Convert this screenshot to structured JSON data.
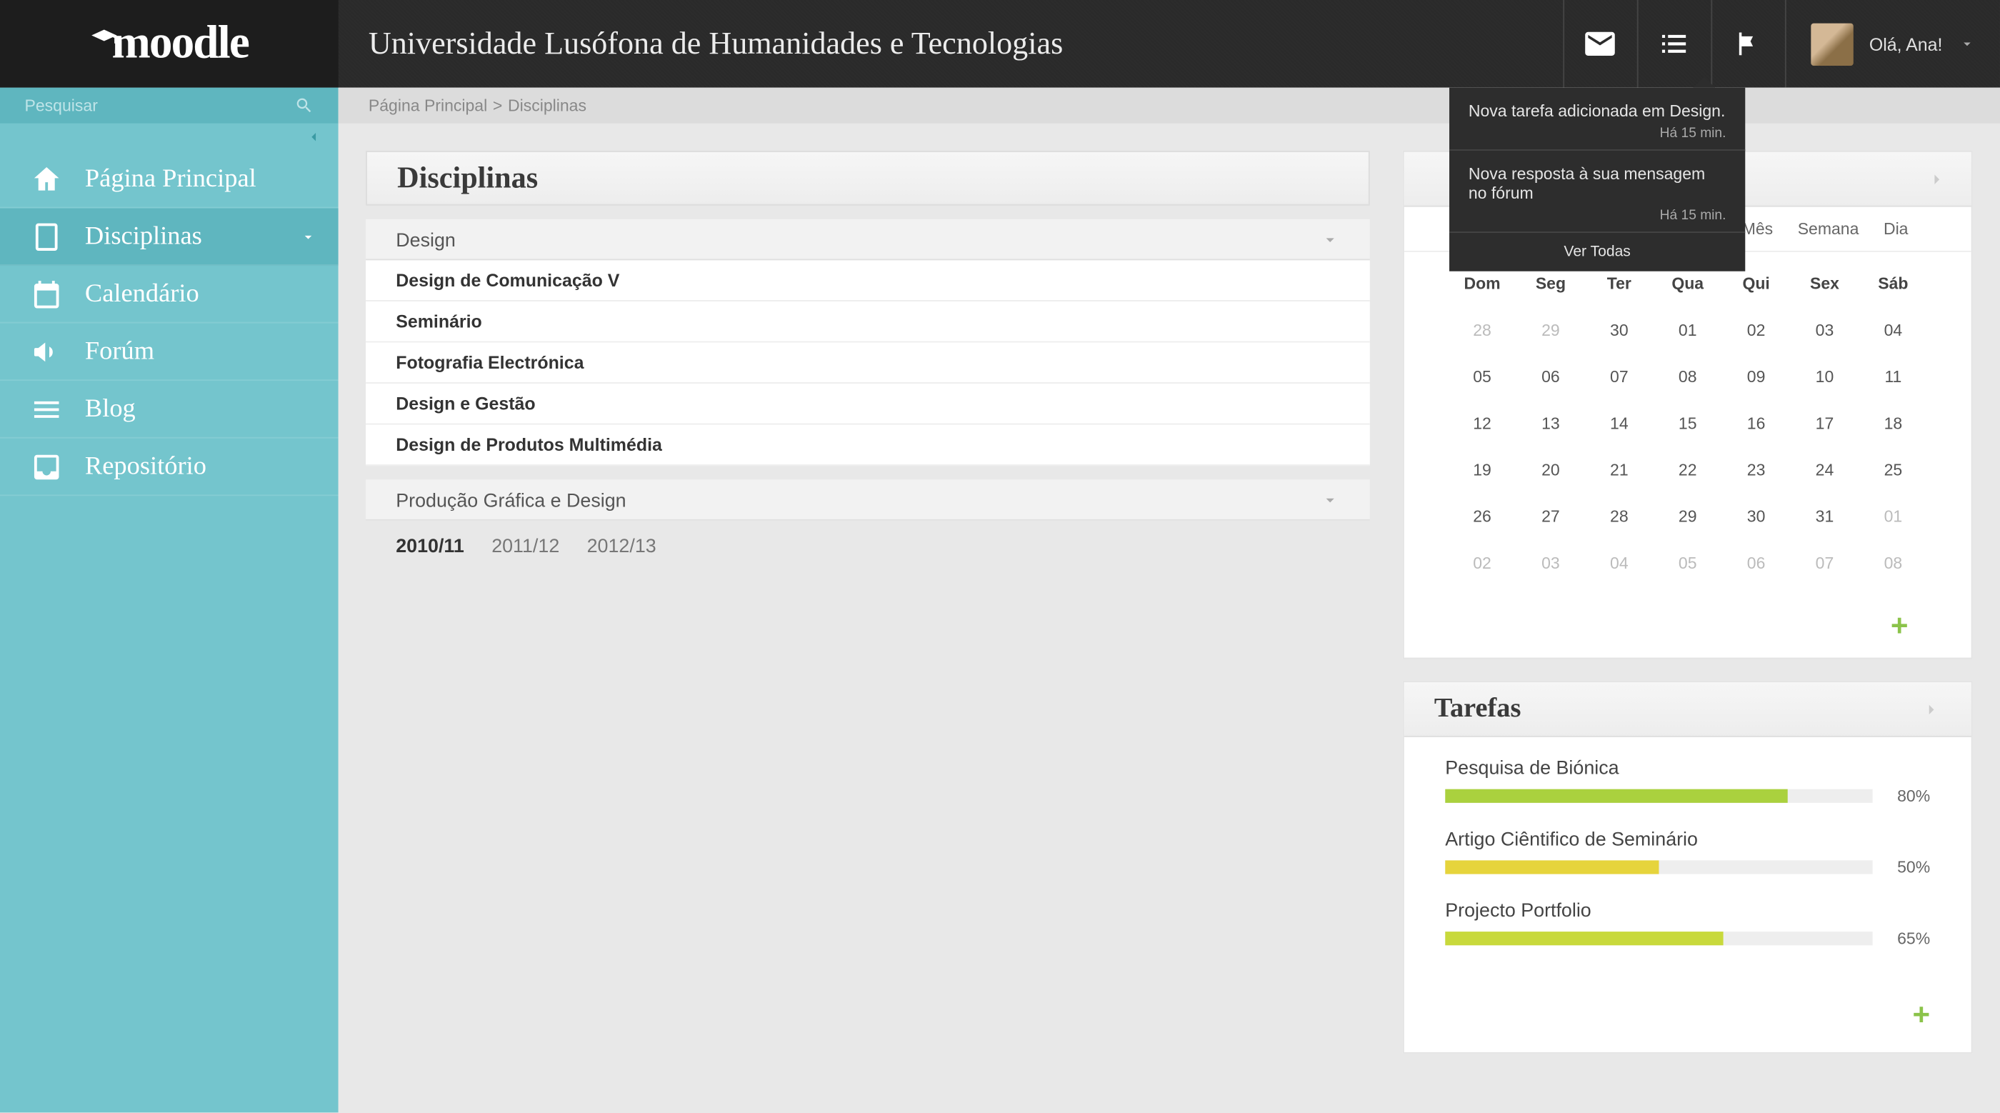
{
  "logo_text": "moodle",
  "header": {
    "university": "Universidade Lusófona de Humanidades e Tecnologias",
    "greeting": "Olá, Ana!"
  },
  "search": {
    "placeholder": "Pesquisar"
  },
  "sidebar": {
    "items": [
      {
        "label": "Página Principal",
        "icon": "home-icon"
      },
      {
        "label": "Disciplinas",
        "icon": "book-icon"
      },
      {
        "label": "Calendário",
        "icon": "calendar-icon"
      },
      {
        "label": "Forúm",
        "icon": "megaphone-icon"
      },
      {
        "label": "Blog",
        "icon": "menu-icon"
      },
      {
        "label": "Repositório",
        "icon": "inbox-icon"
      }
    ]
  },
  "breadcrumb": {
    "home": "Página Principal",
    "sep": ">",
    "current": "Disciplinas"
  },
  "disciplines": {
    "title": "Disciplinas",
    "groups": [
      {
        "name": "Design",
        "expanded": true,
        "courses": [
          "Design de Comunicação V",
          "Seminário",
          "Fotografia Electrónica",
          "Design e Gestão",
          "Design de Produtos Multimédia"
        ]
      },
      {
        "name": "Produção Gráfica e Design",
        "expanded": false,
        "courses": []
      }
    ],
    "years": [
      "2010/11",
      "2011/12",
      "2012/13"
    ],
    "active_year": "2010/11"
  },
  "calendar": {
    "views": [
      "Mês",
      "Semana",
      "Dia"
    ],
    "weekdays": [
      "Dom",
      "Seg",
      "Ter",
      "Qua",
      "Qui",
      "Sex",
      "Sáb"
    ],
    "weeks": [
      [
        {
          "d": "28",
          "m": true
        },
        {
          "d": "29",
          "m": true
        },
        {
          "d": "30",
          "m": false
        },
        {
          "d": "01",
          "m": false
        },
        {
          "d": "02",
          "m": false
        },
        {
          "d": "03",
          "m": false
        },
        {
          "d": "04",
          "m": false
        }
      ],
      [
        {
          "d": "05",
          "m": false
        },
        {
          "d": "06",
          "m": false
        },
        {
          "d": "07",
          "m": false
        },
        {
          "d": "08",
          "m": false
        },
        {
          "d": "09",
          "m": false
        },
        {
          "d": "10",
          "m": false
        },
        {
          "d": "11",
          "m": false
        }
      ],
      [
        {
          "d": "12",
          "m": false
        },
        {
          "d": "13",
          "m": false
        },
        {
          "d": "14",
          "m": false
        },
        {
          "d": "15",
          "m": false
        },
        {
          "d": "16",
          "m": false
        },
        {
          "d": "17",
          "m": false
        },
        {
          "d": "18",
          "m": false
        }
      ],
      [
        {
          "d": "19",
          "m": false
        },
        {
          "d": "20",
          "m": false
        },
        {
          "d": "21",
          "m": false
        },
        {
          "d": "22",
          "m": false
        },
        {
          "d": "23",
          "m": false
        },
        {
          "d": "24",
          "m": false
        },
        {
          "d": "25",
          "m": false
        }
      ],
      [
        {
          "d": "26",
          "m": false
        },
        {
          "d": "27",
          "m": false
        },
        {
          "d": "28",
          "m": false
        },
        {
          "d": "29",
          "m": false
        },
        {
          "d": "30",
          "m": false
        },
        {
          "d": "31",
          "m": false
        },
        {
          "d": "01",
          "m": true
        }
      ],
      [
        {
          "d": "02",
          "m": true
        },
        {
          "d": "03",
          "m": true
        },
        {
          "d": "04",
          "m": true
        },
        {
          "d": "05",
          "m": true
        },
        {
          "d": "06",
          "m": true
        },
        {
          "d": "07",
          "m": true
        },
        {
          "d": "08",
          "m": true
        }
      ]
    ]
  },
  "tasks": {
    "title": "Tarefas",
    "items": [
      {
        "name": "Pesquisa de Biónica",
        "pct": 80,
        "color": "#aad13e"
      },
      {
        "name": "Artigo Ciêntifico de Seminário",
        "pct": 50,
        "color": "#e6d43c"
      },
      {
        "name": "Projecto Portfolio",
        "pct": 65,
        "color": "#c8d93c"
      }
    ]
  },
  "notifications": {
    "items": [
      {
        "text": "Nova tarefa adicionada em Design.",
        "time": "Há 15 min."
      },
      {
        "text": "Nova resposta à sua mensagem no fórum",
        "time": "Há 15 min."
      }
    ],
    "view_all": "Ver Todas"
  }
}
